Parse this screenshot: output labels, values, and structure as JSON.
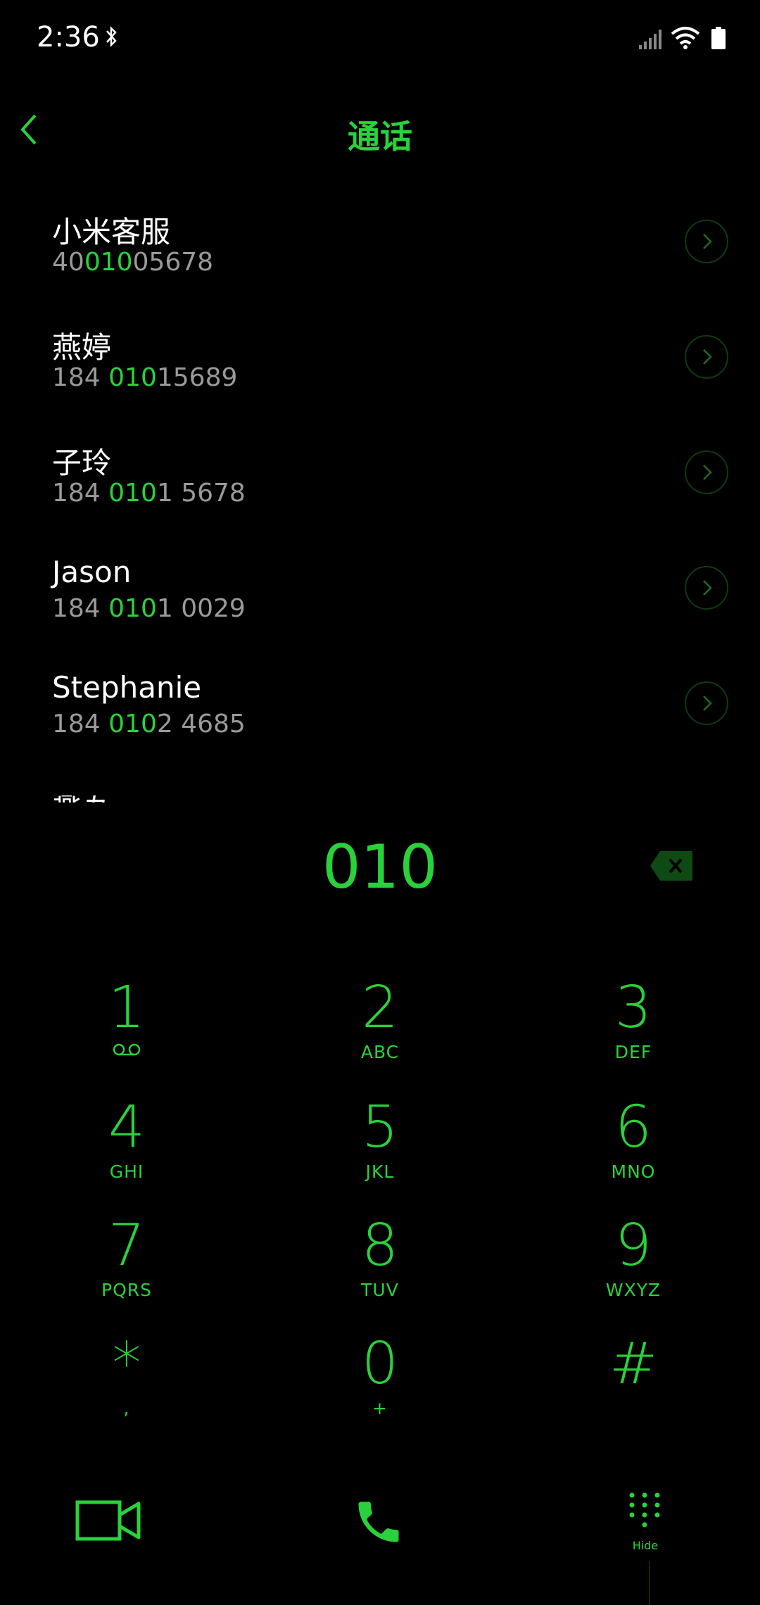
{
  "status_bar": {
    "time": "2:36"
  },
  "header": {
    "title": "通话"
  },
  "contacts": [
    {
      "name": "小米客服",
      "num_pre": "40",
      "num_hl": "010",
      "num_post": "05678"
    },
    {
      "name": "燕婷",
      "num_pre": "184 ",
      "num_hl": "010",
      "num_post": "15689"
    },
    {
      "name": "子玲",
      "num_pre": "184 ",
      "num_hl": "010",
      "num_post": "1 5678"
    },
    {
      "name": "Jason",
      "num_pre": "184 ",
      "num_hl": "010",
      "num_post": "1 0029"
    },
    {
      "name": "Stephanie",
      "num_pre": "184 ",
      "num_hl": "010",
      "num_post": "2 4685"
    }
  ],
  "partial_contact": "燕五",
  "dialer": {
    "input": "010"
  },
  "keypad": [
    {
      "digit": "1",
      "letters": ""
    },
    {
      "digit": "2",
      "letters": "ABC"
    },
    {
      "digit": "3",
      "letters": "DEF"
    },
    {
      "digit": "4",
      "letters": "GHI"
    },
    {
      "digit": "5",
      "letters": "JKL"
    },
    {
      "digit": "6",
      "letters": "MNO"
    },
    {
      "digit": "7",
      "letters": "PQRS"
    },
    {
      "digit": "8",
      "letters": "TUV"
    },
    {
      "digit": "9",
      "letters": "WXYZ"
    },
    {
      "digit": "*",
      "letters": ","
    },
    {
      "digit": "0",
      "letters": "+"
    },
    {
      "digit": "#",
      "letters": ""
    }
  ],
  "bottom_bar": {
    "hide_label": "Hide"
  },
  "colors": {
    "accent": "#29d23b",
    "background": "#000000",
    "secondary_text": "#9a9a9a"
  },
  "icons": [
    "bluetooth-icon",
    "signal-icon",
    "wifi-icon",
    "battery-icon",
    "back-icon",
    "chevron-right-icon",
    "backspace-icon",
    "voicemail-icon",
    "video-call-icon",
    "phone-icon",
    "dialpad-icon"
  ]
}
